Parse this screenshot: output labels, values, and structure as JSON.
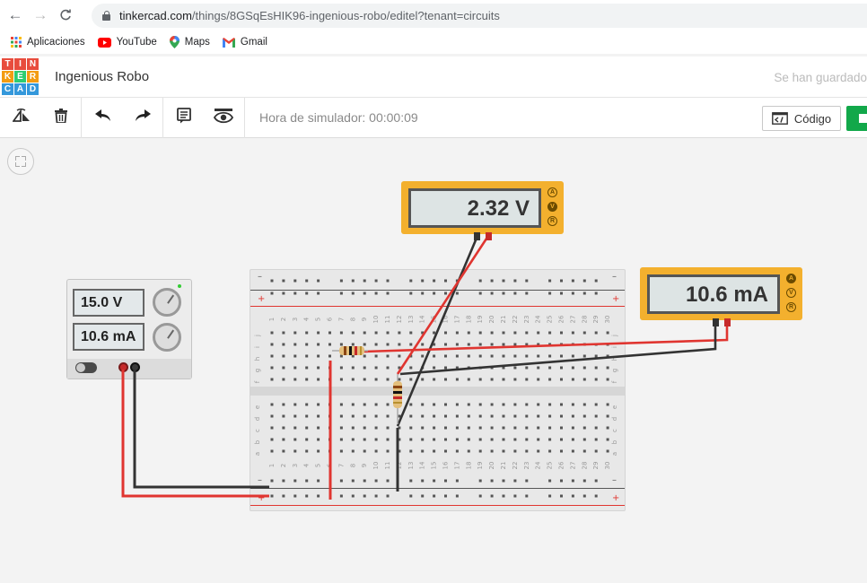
{
  "browser": {
    "url_host": "tinkercad.com",
    "url_path": "/things/8GSqEsHIK96-ingenious-robo/editel?tenant=circuits",
    "bookmarks": [
      {
        "label": "Aplicaciones",
        "icon": "apps-grid-icon"
      },
      {
        "label": "YouTube",
        "icon": "youtube-icon"
      },
      {
        "label": "Maps",
        "icon": "maps-icon"
      },
      {
        "label": "Gmail",
        "icon": "gmail-icon"
      }
    ]
  },
  "app": {
    "logo_letters": [
      "T",
      "I",
      "N",
      "K",
      "E",
      "R",
      "C",
      "A",
      "D"
    ],
    "logo_colors": [
      "#e84c3d",
      "#e84c3d",
      "#e84c3d",
      "#f39c12",
      "#2ecc71",
      "#f39c12",
      "#3498db",
      "#3498db",
      "#3498db"
    ],
    "project_title": "Ingenious Robo",
    "save_status": "Se han guardado"
  },
  "toolbar": {
    "tools": [
      "rotate-icon",
      "trash-icon",
      "undo-icon",
      "redo-icon",
      "notes-icon",
      "visibility-icon"
    ],
    "sim_time": "Hora de simulador: 00:00:09",
    "code_label": "Código"
  },
  "psu": {
    "voltage": "15.0 V",
    "current": "10.6 mA",
    "switch_label": "ON"
  },
  "meter_voltage": {
    "reading": "2.32 V",
    "modes": [
      "A",
      "V",
      "R"
    ],
    "active_mode": "V"
  },
  "meter_current": {
    "reading": "10.6 mA",
    "modes": [
      "A",
      "V",
      "R"
    ],
    "active_mode": "A"
  },
  "breadboard": {
    "rail_minus": "–",
    "rail_plus": "+",
    "rows_top": [
      "j",
      "i",
      "h",
      "g",
      "f"
    ],
    "rows_bottom": [
      "e",
      "d",
      "c",
      "b",
      "a"
    ],
    "columns": 30
  },
  "colors": {
    "wire_red": "#e03530",
    "wire_black": "#333333",
    "meter_body": "#f3b02e",
    "accent_green": "#12a84a"
  }
}
